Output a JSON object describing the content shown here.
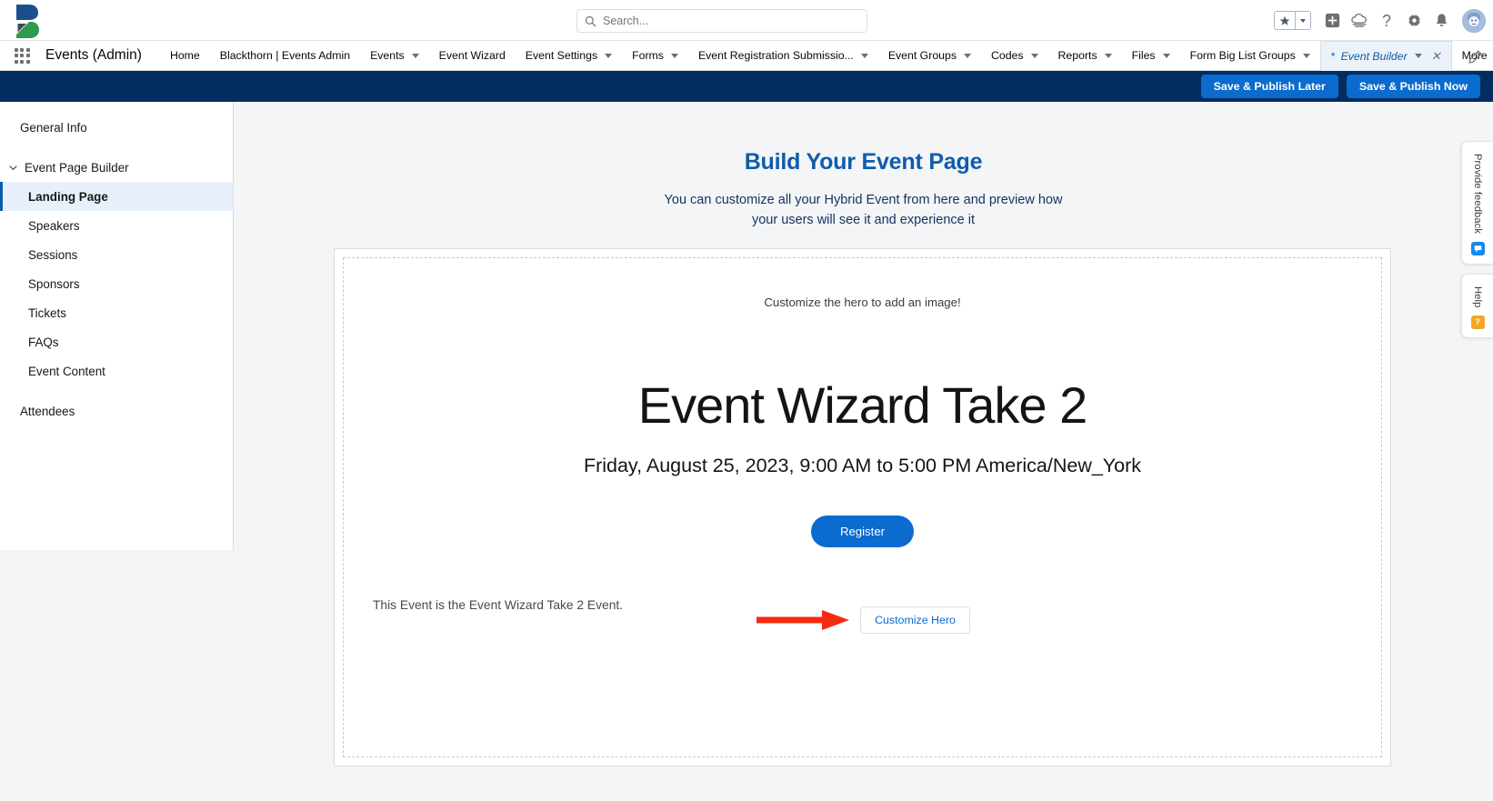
{
  "header": {
    "search": {
      "placeholder": "Search...",
      "value": ""
    },
    "icons": {
      "favorites_star": "star-icon",
      "favorites_caret": "chevron-down-icon",
      "add": "plus-icon",
      "setup_assistant": "cloud-setup-icon",
      "help": "question-mark-icon",
      "setup": "gear-icon",
      "notifications": "bell-icon",
      "avatar": "user-avatar"
    }
  },
  "nav": {
    "app_name": "Events (Admin)",
    "app_launcher": "app-launcher-waffle-icon",
    "items": [
      {
        "label": "Home",
        "has_caret": false,
        "active": false
      },
      {
        "label": "Blackthorn | Events Admin",
        "has_caret": false,
        "active": false
      },
      {
        "label": "Events",
        "has_caret": true,
        "active": false
      },
      {
        "label": "Event Wizard",
        "has_caret": false,
        "active": false
      },
      {
        "label": "Event Settings",
        "has_caret": true,
        "active": false
      },
      {
        "label": "Forms",
        "has_caret": true,
        "active": false
      },
      {
        "label": "Event Registration Submissio...",
        "has_caret": true,
        "active": false
      },
      {
        "label": "Event Groups",
        "has_caret": true,
        "active": false
      },
      {
        "label": "Codes",
        "has_caret": true,
        "active": false
      },
      {
        "label": "Reports",
        "has_caret": true,
        "active": false
      },
      {
        "label": "Files",
        "has_caret": true,
        "active": false
      },
      {
        "label": "Form Big List Groups",
        "has_caret": true,
        "active": false
      },
      {
        "label": "Event Builder",
        "has_caret": true,
        "active": true,
        "unsaved_marker": "*",
        "closeable": true
      },
      {
        "label": "More",
        "has_caret": true,
        "active": false
      }
    ],
    "edit_icon": "pencil-icon"
  },
  "action_bar": {
    "save_publish_later": "Save & Publish Later",
    "save_publish_now": "Save & Publish Now"
  },
  "sidebar": {
    "items": [
      {
        "label": "General Info",
        "type": "item",
        "active": false
      },
      {
        "label": "Event Page Builder",
        "type": "group",
        "expanded": true,
        "icon": "chevron-down-icon",
        "active": false
      },
      {
        "label": "Landing Page",
        "type": "sub",
        "active": true
      },
      {
        "label": "Speakers",
        "type": "sub",
        "active": false
      },
      {
        "label": "Sessions",
        "type": "sub",
        "active": false
      },
      {
        "label": "Sponsors",
        "type": "sub",
        "active": false
      },
      {
        "label": "Tickets",
        "type": "sub",
        "active": false
      },
      {
        "label": "FAQs",
        "type": "sub",
        "active": false
      },
      {
        "label": "Event Content",
        "type": "sub",
        "active": false
      },
      {
        "label": "Attendees",
        "type": "item",
        "active": false
      }
    ]
  },
  "main": {
    "title": "Build Your Event Page",
    "subtitle": "You can customize all your Hybrid Event from here and preview how your users will see it and experience it",
    "hero": {
      "image_hint": "Customize the hero to add an image!",
      "event_title": "Event Wizard Take 2",
      "event_date": "Friday, August 25, 2023, 9:00 AM to 5:00 PM America/New_York",
      "register_label": "Register",
      "description": "This Event is the Event Wizard Take 2 Event.",
      "customize_label": "Customize Hero",
      "annotation_arrow": "red-arrow-pointer"
    }
  },
  "edge_tabs": [
    {
      "label": "Provide feedback",
      "badge_icon": "feedback-icon",
      "badge_color": "#1589ee"
    },
    {
      "label": "Help",
      "badge_icon": "help-icon",
      "badge_color": "#f5a623"
    }
  ],
  "colors": {
    "brand_blue": "#0b6bce",
    "dark_navy": "#032d60",
    "title_blue": "#0f5cab",
    "annotation_red": "#f42b11",
    "page_bg": "#f3f5f7"
  }
}
